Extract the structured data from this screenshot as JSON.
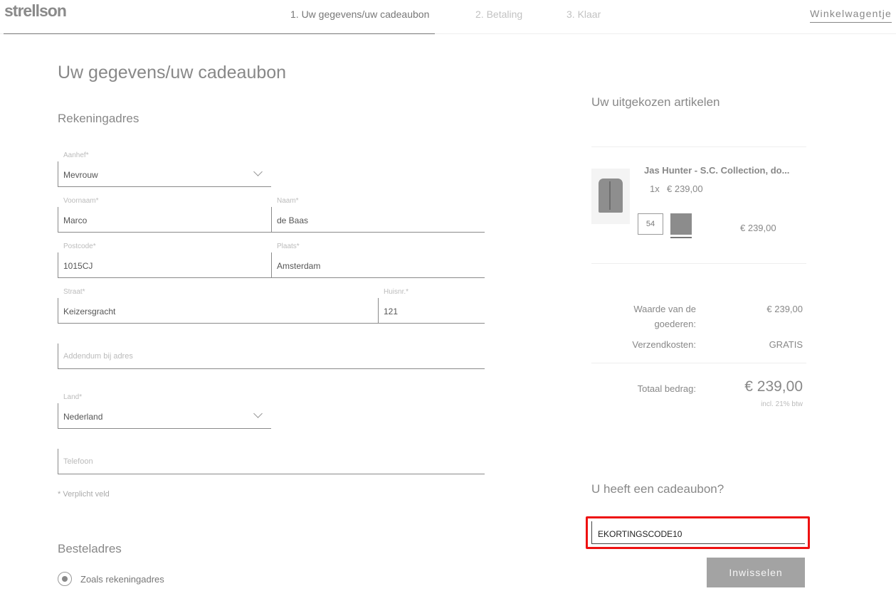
{
  "header": {
    "logo": "strellson",
    "steps": [
      {
        "label": "1. Uw gegevens/uw cadeaubon",
        "active": true
      },
      {
        "label": "2. Betaling",
        "active": false
      },
      {
        "label": "3. Klaar",
        "active": false
      }
    ],
    "cart_link": "Winkelwagentje"
  },
  "form": {
    "page_title": "Uw gegevens/uw cadeaubon",
    "billing_title": "Rekeningadres",
    "salutation": {
      "label": "Aanhef*",
      "value": "Mevrouw"
    },
    "first_name": {
      "label": "Voornaam*",
      "value": "Marco"
    },
    "last_name": {
      "label": "Naam*",
      "value": "de Baas"
    },
    "postcode": {
      "label": "Postcode*",
      "value": "1015CJ"
    },
    "city": {
      "label": "Plaats*",
      "value": "Amsterdam"
    },
    "street": {
      "label": "Straat*",
      "value": "Keizersgracht"
    },
    "house_number": {
      "label": "Huisnr.*",
      "value": "121"
    },
    "addendum": {
      "placeholder": "Addendum bij adres"
    },
    "country": {
      "label": "Land*",
      "value": "Nederland"
    },
    "phone": {
      "placeholder": "Telefoon"
    },
    "required_note": "* Verplicht veld",
    "shipping_title": "Besteladres",
    "shipping_option": "Zoals rekeningadres"
  },
  "summary": {
    "title": "Uw uitgekozen artikelen",
    "product": {
      "name": "Jas Hunter - S.C. Collection, do...",
      "qty": "1x",
      "unit_price": "€ 239,00",
      "size": "54",
      "total": "€ 239,00",
      "color": "#8c8c8c"
    },
    "goods_label": "Waarde van de goederen:",
    "goods_value": "€ 239,00",
    "shipping_label": "Verzendkosten:",
    "shipping_value": "GRATIS",
    "total_label": "Totaal bedrag:",
    "total_value": "€ 239,00",
    "vat_note": "incl. 21% btw"
  },
  "voucher": {
    "title": "U heeft een cadeaubon?",
    "value": "EKORTINGSCODE10",
    "button_label": "Inwisselen",
    "highlight_color": "#ee1111"
  }
}
